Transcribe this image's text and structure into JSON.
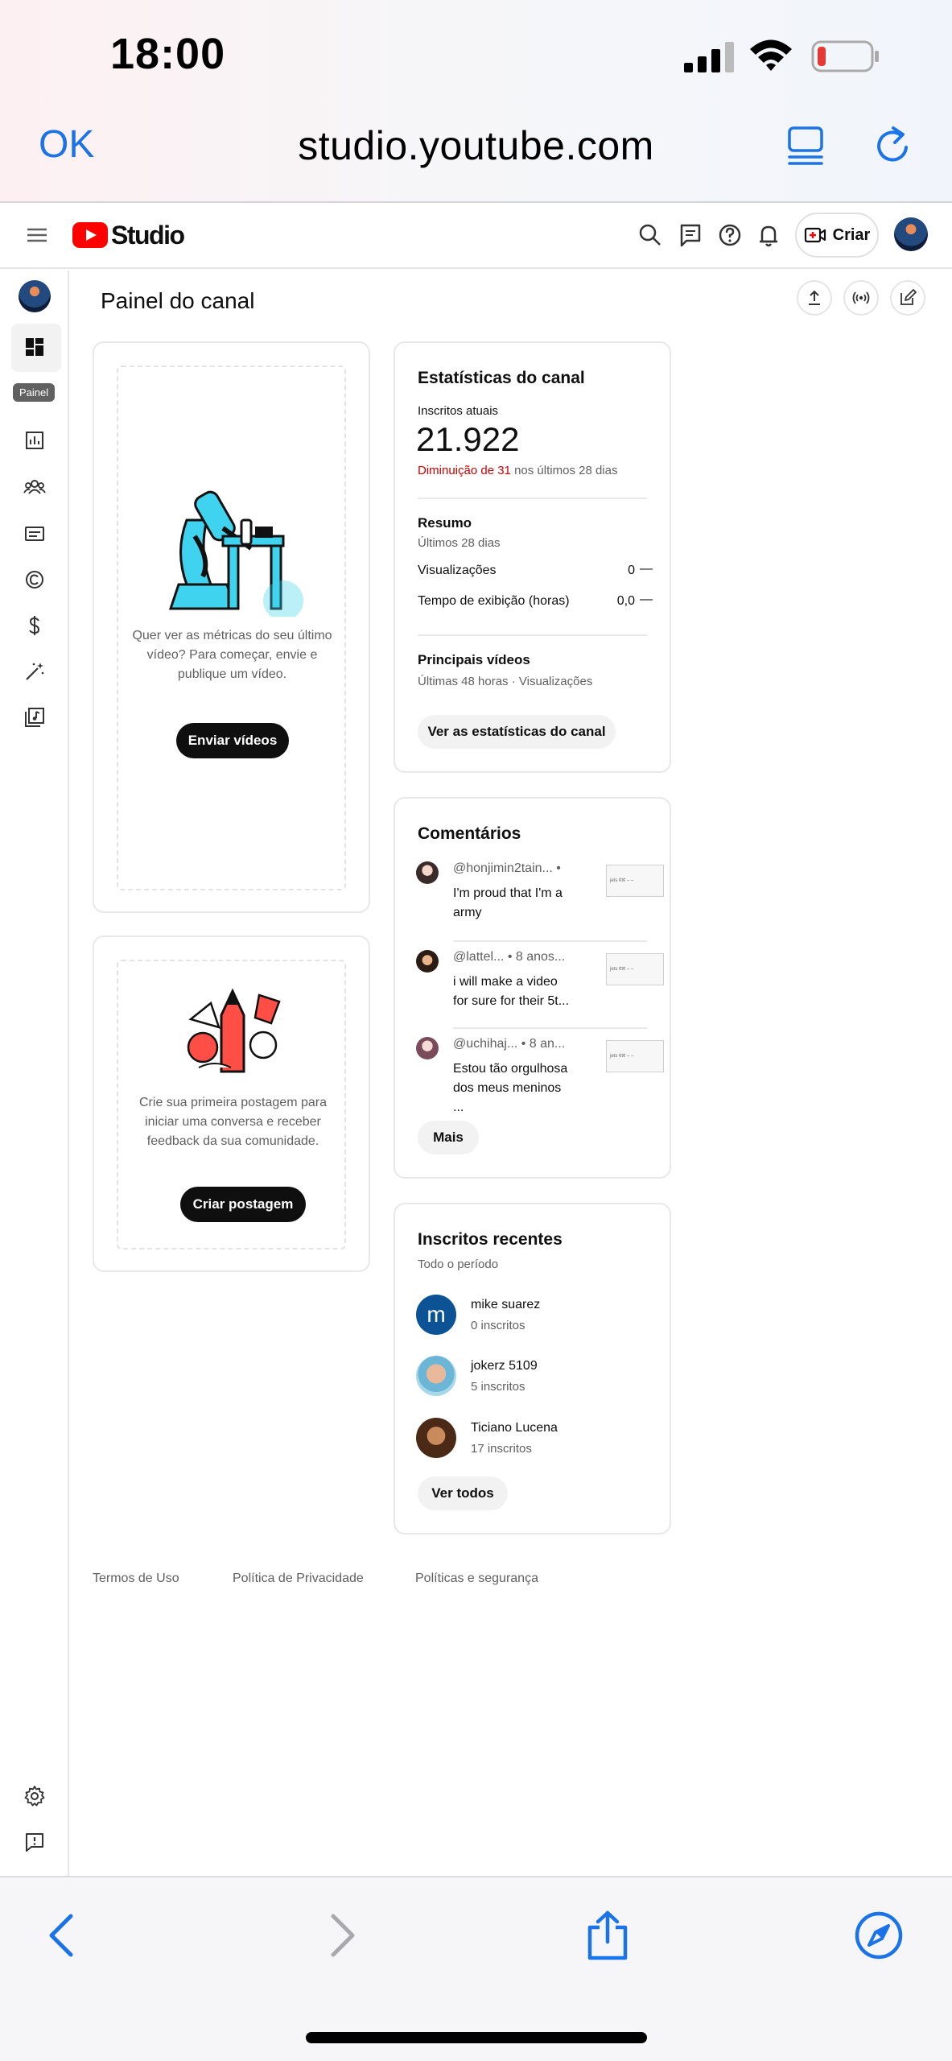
{
  "status_bar": {
    "time": "18:00"
  },
  "browser": {
    "ok_label": "OK",
    "url": "studio.youtube.com"
  },
  "header": {
    "logo_text": "Studio",
    "create_label": "Criar"
  },
  "sidebar": {
    "tooltip": "Painel"
  },
  "page": {
    "title": "Painel do canal"
  },
  "video_card": {
    "text": "Quer ver as métricas do seu último vídeo? Para começar, envie e publique um vídeo.",
    "button": "Enviar vídeos"
  },
  "post_card": {
    "text": "Crie sua primeira postagem para iniciar uma conversa e receber feedback da sua comunidade.",
    "button": "Criar postagem"
  },
  "stats": {
    "title": "Estatísticas do canal",
    "subs_label": "Inscritos atuais",
    "subs_value": "21.922",
    "change_red": "Diminuição de 31",
    "change_rest": " nos últimos 28 dias",
    "summary_title": "Resumo",
    "summary_period": "Últimos 28 dias",
    "rows": [
      {
        "label": "Visualizações",
        "value": "0",
        "trend": "—"
      },
      {
        "label": "Tempo de exibição (horas)",
        "value": "0,0",
        "trend": "—"
      }
    ],
    "top_title": "Principais vídeos",
    "top_period": "Últimas 48 horas · Visualizações",
    "button": "Ver as estatísticas do canal"
  },
  "comments": {
    "title": "Comentários",
    "items": [
      {
        "author": "@honjimin2tain... •",
        "text": "I'm proud that I'm a army",
        "thumb": "jets ¢t¢ – –"
      },
      {
        "author": "@lattel... • 8 anos...",
        "text": "i will make a video for sure for their 5t...",
        "thumb": "jets ¢t¢ – –"
      },
      {
        "author": "@uchihaj... • 8 an...",
        "text": "Estou tão orgulhosa dos meus meninos ...",
        "thumb": "jets ¢t¢ – –"
      }
    ],
    "button": "Mais"
  },
  "recent_subs": {
    "title": "Inscritos recentes",
    "period": "Todo o período",
    "items": [
      {
        "initial": "m",
        "name": "mike suarez",
        "count": "0 inscritos"
      },
      {
        "initial": "",
        "name": "jokerz 5109",
        "count": "5 inscritos"
      },
      {
        "initial": "",
        "name": "Ticiano Lucena",
        "count": "17 inscritos"
      }
    ],
    "button": "Ver todos"
  },
  "footer": {
    "terms": "Termos de Uso",
    "privacy": "Política de Privacidade",
    "policies": "Políticas e segurança"
  },
  "colors": {
    "brand_red": "#ff0000",
    "ios_blue": "#1a73e8",
    "decrease_red": "#cc0000",
    "illustration_cyan": "#3fd3ef"
  }
}
